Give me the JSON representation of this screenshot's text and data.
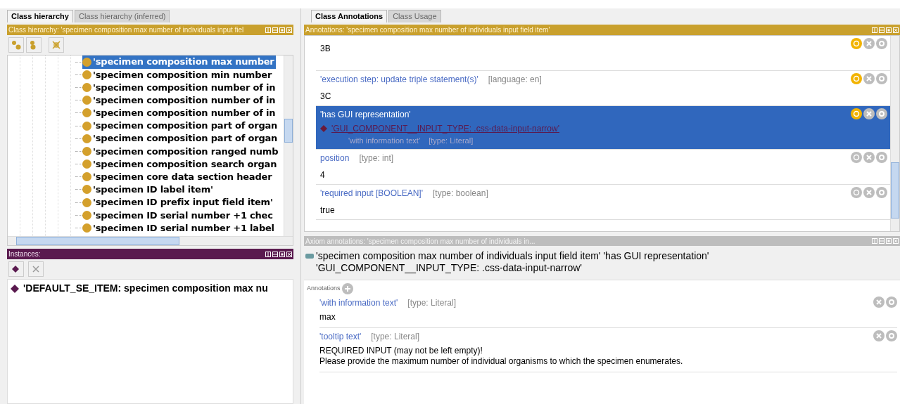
{
  "left": {
    "tabs": [
      {
        "label": "Class hierarchy",
        "selected": true
      },
      {
        "label": "Class hierarchy (inferred)",
        "selected": false
      }
    ],
    "hierarchy": {
      "title": "Class hierarchy: 'specimen composition max number of individuals input fiel",
      "items": [
        {
          "label": "'specimen composition max number",
          "selected": true
        },
        {
          "label": "'specimen composition min number",
          "selected": false
        },
        {
          "label": "'specimen composition number of in",
          "selected": false
        },
        {
          "label": "'specimen composition number of in",
          "selected": false
        },
        {
          "label": "'specimen composition number of in",
          "selected": false
        },
        {
          "label": "'specimen composition part of organ",
          "selected": false
        },
        {
          "label": "'specimen composition part of organ",
          "selected": false
        },
        {
          "label": "'specimen composition ranged numb",
          "selected": false
        },
        {
          "label": "'specimen composition search organ",
          "selected": false
        },
        {
          "label": "'specimen core data section header",
          "selected": false
        },
        {
          "label": "'specimen ID label item'",
          "selected": false
        },
        {
          "label": "'specimen ID prefix input field item'",
          "selected": false
        },
        {
          "label": "'specimen ID serial number +1 chec",
          "selected": false
        },
        {
          "label": "'specimen ID serial number +1 label",
          "selected": false
        }
      ]
    },
    "instances": {
      "title": "Instances:",
      "items": [
        "'DEFAULT_SE_ITEM: specimen composition max nu"
      ]
    }
  },
  "right": {
    "tabs": [
      {
        "label": "Class Annotations",
        "selected": true
      },
      {
        "label": "Class Usage",
        "selected": false
      }
    ],
    "annotations": {
      "title": "Annotations: 'specimen composition max number of individuals input field item'",
      "rows": [
        {
          "kind": "text",
          "property": "",
          "qualifier": "",
          "value": "3B",
          "selected": false,
          "annotated": true
        },
        {
          "kind": "text",
          "property": "'execution step: update triple statement(s)'",
          "qualifier": "[language: en]",
          "value": "3C",
          "selected": false,
          "annotated": true
        },
        {
          "kind": "individual",
          "property": "'has GUI representation'",
          "qualifier": "",
          "value": "'GUI_COMPONENT__INPUT_TYPE: .css-data-input-narrow'",
          "sub": "'with information text'    [type: Literal]",
          "selected": true,
          "annotated": true
        },
        {
          "kind": "text",
          "property": "position",
          "qualifier": "[type: int]",
          "value": "4",
          "selected": false,
          "annotated": false
        },
        {
          "kind": "text",
          "property": "'required input [BOOLEAN]'",
          "qualifier": "[type: boolean]",
          "value": "true",
          "selected": false,
          "annotated": false
        }
      ]
    },
    "axiom": {
      "title": "Axiom annotations: 'specimen composition max number of individuals in...",
      "lines": [
        "'specimen composition max number of individuals input field item' 'has GUI representation'",
        "'GUI_COMPONENT__INPUT_TYPE: .css-data-input-narrow'"
      ],
      "heading": "Annotations",
      "rows": [
        {
          "property": "'with information text'",
          "qualifier": "[type: Literal]",
          "lines": [
            "max"
          ]
        },
        {
          "property": "'tooltip text'",
          "qualifier": "[type: Literal]",
          "lines": [
            "REQUIRED INPUT (may not be left empty)!",
            "Please provide the maximum number of individual organisms to which the specimen enumerates."
          ]
        }
      ]
    }
  }
}
